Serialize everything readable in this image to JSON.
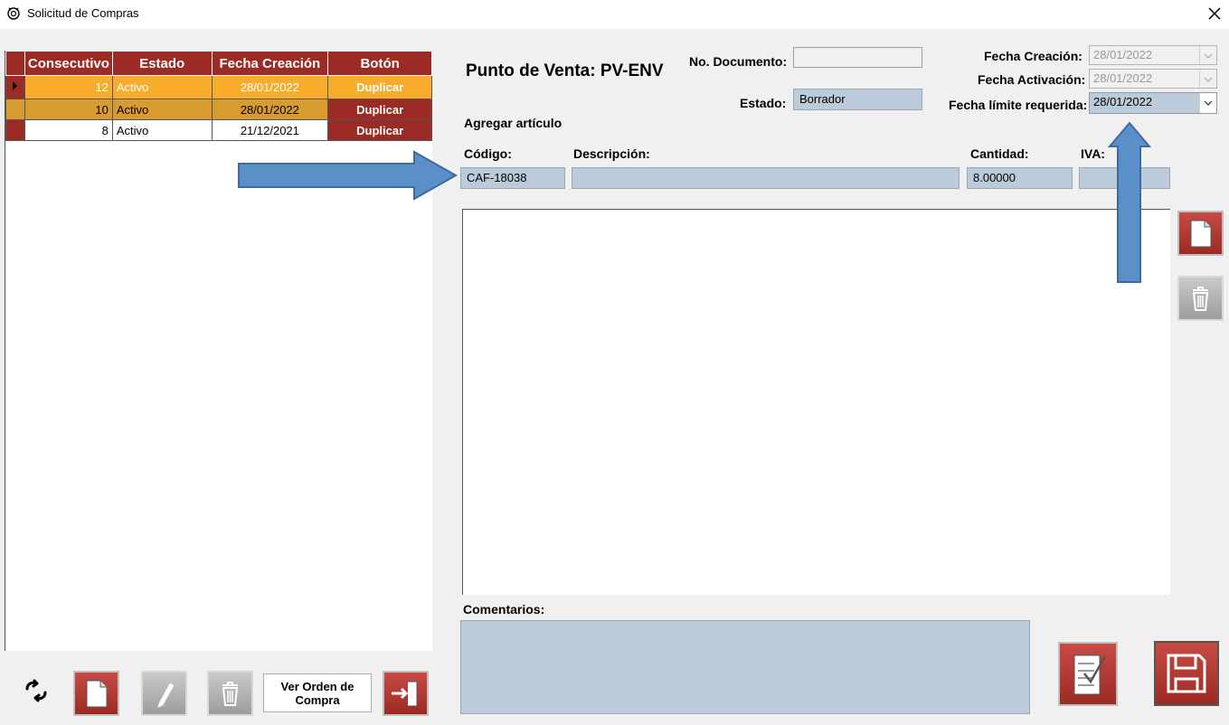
{
  "window": {
    "title": "Solicitud de Compras"
  },
  "grid": {
    "headers": [
      "Consecutivo",
      "Estado",
      "Fecha Creación",
      "Botón"
    ],
    "rows": [
      {
        "consecutivo": "12",
        "estado": "Activo",
        "fecha": "28/01/2022",
        "boton": "Duplicar"
      },
      {
        "consecutivo": "10",
        "estado": "Activo",
        "fecha": "28/01/2022",
        "boton": "Duplicar"
      },
      {
        "consecutivo": "8",
        "estado": "Activo",
        "fecha": "21/12/2021",
        "boton": "Duplicar"
      }
    ]
  },
  "header": {
    "punto_venta": "Punto de Venta: PV-ENV",
    "no_documento_label": "No. Documento:",
    "no_documento_value": "",
    "estado_label": "Estado:",
    "estado_value": "Borrador",
    "fecha_creacion_label": "Fecha Creación:",
    "fecha_creacion_value": "28/01/2022",
    "fecha_activacion_label": "Fecha Activación:",
    "fecha_activacion_value": "28/01/2022",
    "fecha_limite_label": "Fecha límite requerida:",
    "fecha_limite_value": "28/01/2022"
  },
  "add_item": {
    "title": "Agregar artículo",
    "codigo_label": "Código:",
    "codigo_value": "CAF-18038",
    "descripcion_label": "Descripción:",
    "descripcion_value": "",
    "cantidad_label": "Cantidad:",
    "cantidad_value": "8.00000",
    "iva_label": "IVA:",
    "iva_value": ""
  },
  "comments": {
    "label": "Comentarios:",
    "value": ""
  },
  "buttons": {
    "ver_orden": "Ver Orden de Compra"
  },
  "colors": {
    "accent": "#9b2b24",
    "selected_row": "#f7ad2b",
    "field": "#bccbd9",
    "arrow": "#5b8fc7"
  }
}
